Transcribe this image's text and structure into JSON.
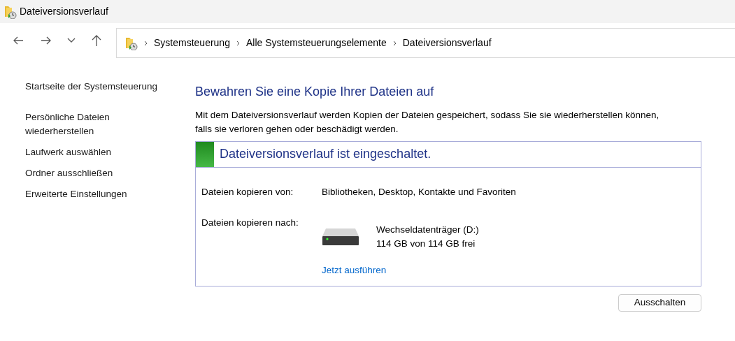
{
  "window": {
    "title": "Dateiversionsverlauf"
  },
  "breadcrumb": [
    "Systemsteuerung",
    "Alle Systemsteuerungselemente",
    "Dateiversionsverlauf"
  ],
  "sidebar": {
    "items": [
      {
        "label": "Startseite der Systemsteuerung"
      },
      {
        "label": "Persönliche Dateien wiederherstellen"
      },
      {
        "label": "Laufwerk auswählen"
      },
      {
        "label": "Ordner ausschließen"
      },
      {
        "label": "Erweiterte Einstellungen"
      }
    ]
  },
  "heading": "Bewahren Sie eine Kopie Ihrer Dateien auf",
  "description": "Mit dem Dateiversionsverlauf werden Kopien der Dateien gespeichert, sodass Sie sie wiederherstellen können, falls sie verloren gehen oder beschädigt werden.",
  "status": {
    "on": true,
    "title": "Dateiversionsverlauf ist eingeschaltet.",
    "copy_from_label": "Dateien kopieren von:",
    "copy_from": "Bibliotheken, Desktop, Kontakte und Favoriten",
    "copy_to_label": "Dateien kopieren nach:",
    "drive_name": "Wechseldatenträger (D:)",
    "drive_space": "114 GB von 114 GB frei",
    "run_link": "Jetzt ausführen"
  },
  "buttons": [
    "Ausschalten"
  ]
}
